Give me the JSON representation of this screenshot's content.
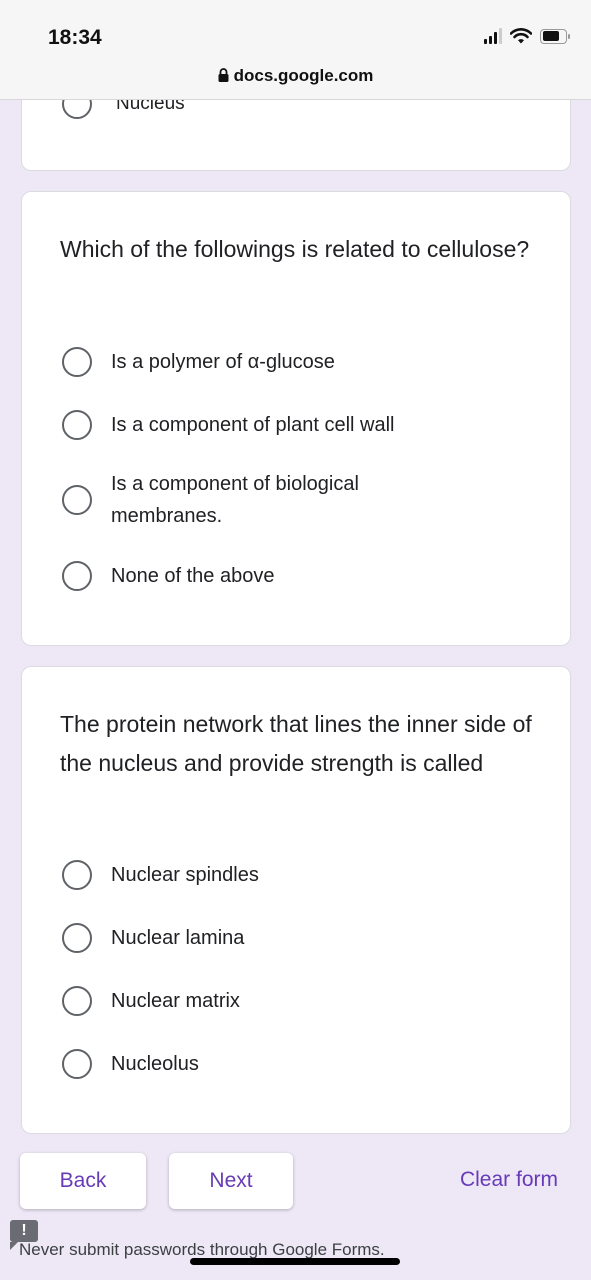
{
  "status_bar": {
    "time": "18:34",
    "icons": [
      "signal-icon",
      "wifi-icon",
      "battery-icon"
    ]
  },
  "browser": {
    "url": "docs.google.com",
    "lock_icon": "lock-icon"
  },
  "previous_question": {
    "partial_option": "Nucleus"
  },
  "questions": [
    {
      "title": "Which of the followings is related to cellulose?",
      "options": [
        {
          "label": "Is a polymer of α-glucose",
          "selected": false
        },
        {
          "label": "Is a component of plant cell wall",
          "selected": false
        },
        {
          "label": "Is a component of biological membranes.",
          "selected": false
        },
        {
          "label": "None of the above",
          "selected": false
        }
      ]
    },
    {
      "title": "The protein network that lines the inner side of the nucleus and provide strength is called",
      "options": [
        {
          "label": "Nuclear spindles",
          "selected": false
        },
        {
          "label": "Nuclear lamina",
          "selected": false
        },
        {
          "label": "Nuclear matrix",
          "selected": false
        },
        {
          "label": "Nucleolus",
          "selected": false
        }
      ]
    }
  ],
  "navigation": {
    "back_label": "Back",
    "next_label": "Next",
    "clear_label": "Clear form"
  },
  "footer": {
    "warning_icon": "!",
    "note": "Never submit passwords through Google Forms."
  },
  "colors": {
    "accent": "#673ab7",
    "background": "#ede7f6"
  }
}
